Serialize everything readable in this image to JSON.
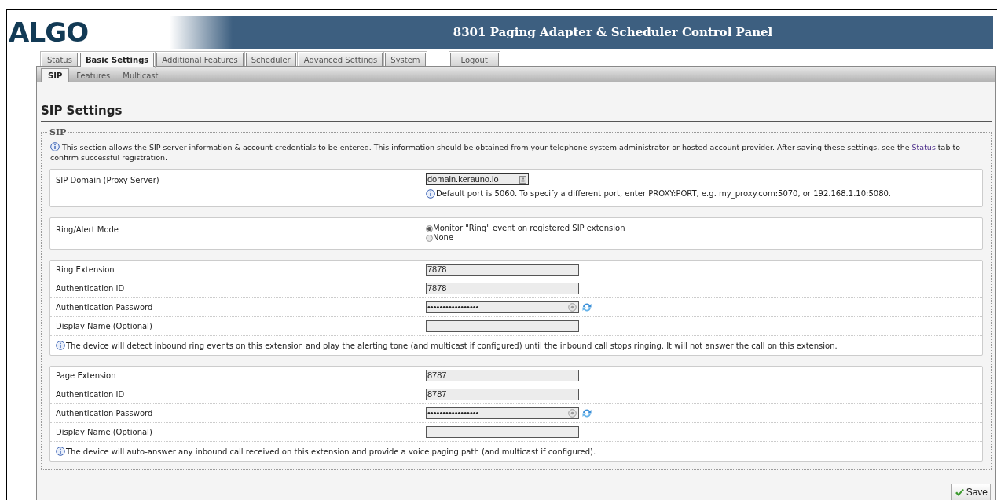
{
  "header": {
    "logo": "ALGO",
    "title": "8301 Paging Adapter & Scheduler Control Panel"
  },
  "tabs": [
    {
      "label": "Status",
      "selected": false
    },
    {
      "label": "Basic Settings",
      "selected": true
    },
    {
      "label": "Additional Features",
      "selected": false
    },
    {
      "label": "Scheduler",
      "selected": false
    },
    {
      "label": "Advanced Settings",
      "selected": false
    },
    {
      "label": "System",
      "selected": false
    },
    {
      "label": "Logout",
      "selected": false,
      "kind": "logout"
    }
  ],
  "subtabs": [
    {
      "label": "SIP",
      "selected": true
    },
    {
      "label": "Features",
      "selected": false
    },
    {
      "label": "Multicast",
      "selected": false
    }
  ],
  "heading": "SIP Settings",
  "section": {
    "legend": "SIP",
    "intro_before": "This section allows the SIP server information & account credentials to be entered. This information should be obtained from your telephone system administrator or hosted account provider. After saving these settings, see the ",
    "intro_link": "Status",
    "intro_after": " tab to confirm successful registration.",
    "groups": [
      {
        "rows": [
          {
            "kind": "domain_field",
            "label": "SIP Domain (Proxy Server)",
            "value": "domain.kerauno.io",
            "hint": "Default port is 5060. To specify a different port, enter PROXY:PORT, e.g. my_proxy.com:5070, or 192.168.1.10:5080."
          }
        ]
      },
      {
        "rows": [
          {
            "kind": "radio",
            "label": "Ring/Alert Mode",
            "options": [
              {
                "label": "Monitor \"Ring\" event on registered SIP extension",
                "selected": true
              },
              {
                "label": "None",
                "selected": false
              }
            ]
          }
        ]
      },
      {
        "rows": [
          {
            "kind": "text_field",
            "label": "Ring Extension",
            "value": "7878"
          },
          {
            "kind": "text_field",
            "label": "Authentication ID",
            "value": "7878"
          },
          {
            "kind": "password_field",
            "label": "Authentication Password",
            "value": "•••••••••••••••••"
          },
          {
            "kind": "text_field",
            "label": "Display Name (Optional)"
          },
          {
            "kind": "note",
            "text": "The device will detect inbound ring events on this extension and play the alerting tone (and multicast if configured) until the inbound call stops ringing. It will not answer the call on this extension."
          }
        ]
      },
      {
        "rows": [
          {
            "kind": "text_field",
            "label": "Page Extension",
            "value": "8787"
          },
          {
            "kind": "text_field",
            "label": "Authentication ID",
            "value": "8787"
          },
          {
            "kind": "password_field",
            "label": "Authentication Password",
            "value": "•••••••••••••••••"
          },
          {
            "kind": "text_field",
            "label": "Display Name (Optional)"
          },
          {
            "kind": "note",
            "text": "The device will auto-answer any inbound call received on this extension and provide a voice paging path (and multicast if configured)."
          }
        ]
      }
    ]
  },
  "save_button": "Save"
}
